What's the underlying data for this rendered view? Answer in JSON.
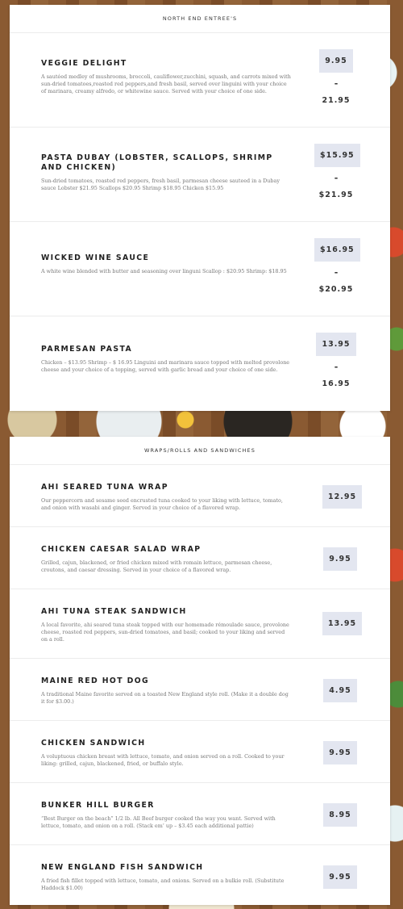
{
  "entrees": {
    "title": "NORTH END ENTREE'S",
    "items": [
      {
        "name": "VEGGIE DELIGHT",
        "description": "A sautéed medley of mushrooms, broccoli, cauliflower,zucchini, squash, and carrots mixed with sun-dried tomatoes,roasted red peppers,and fresh basil, served over linguini with your choice of marinara, creamy alfredo, or whitewine sauce. Served with your choice of one side.",
        "price_low": "9.95",
        "separator": "-",
        "price_high": "21.95"
      },
      {
        "name": "PASTA DUBAY (LOBSTER, SCALLOPS, SHRIMP AND CHICKEN)",
        "description": "Sun-dried tomatoes, roasted red peppers, fresh basil, parmesan cheese sauteed in a Dubay sauce Lobster $21.95 Scallops $20.95 Shrimp $18.95 Chicken $15.95",
        "price_low": "$15.95",
        "separator": "-",
        "price_high": "$21.95"
      },
      {
        "name": "WICKED WINE SAUCE",
        "description": "A white wine blended with butter and seasoning over linguni Scallop : $20.95 Shrimp: $18.95",
        "price_low": "$16.95",
        "separator": "-",
        "price_high": "$20.95"
      },
      {
        "name": "PARMESAN PASTA",
        "description": "Chicken – $13.95 Shrimp – $ 16.95 Linguini and marinara sauce topped with melted provolone cheese and your choice of a topping, served with garlic bread and your choice of one side.",
        "price_low": "13.95",
        "separator": "-",
        "price_high": "16.95"
      }
    ]
  },
  "wraps": {
    "title": "WRAPS/ROLLS AND SANDWICHES",
    "items": [
      {
        "name": "AHI SEARED TUNA WRAP",
        "description": "Our peppercorn and sesame seed encrusted tuna cooked to your liking with lettuce, tomato, and onion with wasabi and ginger. Served in your choice of a flavored wrap.",
        "price": "12.95"
      },
      {
        "name": "CHICKEN CAESAR SALAD WRAP",
        "description": "Grilled, cajun, blackened, or fried chicken mixed with romain lettuce, parmesan cheese, croutons, and caesar dressing. Served in your choice of a flavored wrap.",
        "price": "9.95"
      },
      {
        "name": "AHI TUNA STEAK SANDWICH",
        "description": "A local favorite, ahi seared tuna steak topped with our homemade rémoulade sauce, provolone cheese, roasted red peppers, sun-dried tomatoes, and basil; cooked to your liking and served on a roll.",
        "price": "13.95"
      },
      {
        "name": "MAINE RED HOT DOG",
        "description": "A traditional Maine favorite served on a toasted New England style roll. (Make it a double dog it for $3.00.)",
        "price": "4.95"
      },
      {
        "name": "CHICKEN SANDWICH",
        "description": "A voluptuous chicken breast with lettuce, tomato, and onion served on a roll. Cooked to your liking: grilled, cajun, blackened, fried, or buffalo style.",
        "price": "9.95"
      },
      {
        "name": "BUNKER HILL BURGER",
        "description": "“Best Burger on the beach” 1/2 lb. All Beef burger cooked the way you want. Served with lettuce, tomato, and onion on a roll. (Stack em’ up – $3.45 each additional pattie)",
        "price": "8.95"
      },
      {
        "name": "NEW ENGLAND FISH SANDWICH",
        "description": "A fried fish fillet topped with lettuce, tomato, and onions. Served on a bulkie roll. (Substitute Haddock $1.00)",
        "price": "9.95"
      }
    ]
  }
}
